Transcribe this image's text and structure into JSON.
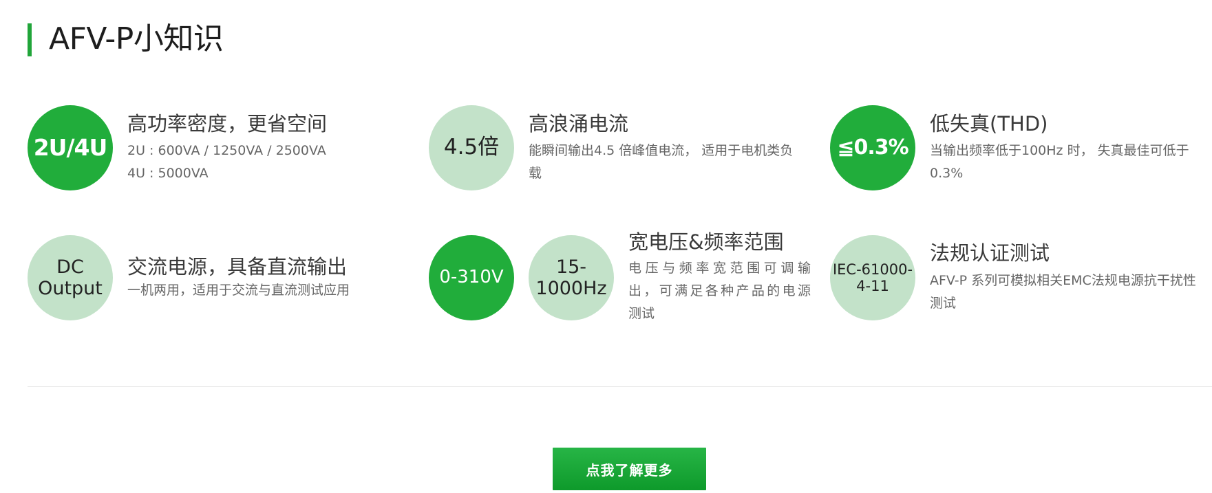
{
  "header": {
    "title": "AFV-P小知识"
  },
  "features": [
    {
      "badge": "2U/4U",
      "title": "高功率密度，更省空间",
      "lines": [
        "2U : 600VA / 1250VA / 2500VA",
        "4U : 5000VA"
      ]
    },
    {
      "badge": "4.5倍",
      "title": "高浪涌电流",
      "lines": [
        "能瞬间输出4.5 倍峰值电流， 适用于电机类负",
        "载"
      ]
    },
    {
      "badge": "≦0.3%",
      "title": "低失真(THD)",
      "lines": [
        "当输出频率低于100Hz 时， 失真最佳可低于",
        "0.3%"
      ]
    },
    {
      "badge_lines": [
        "DC",
        "Output"
      ],
      "title": "交流电源，具备直流输出",
      "lines": [
        "一机两用，适用于交流与直流测试应用"
      ]
    },
    {
      "badges": [
        {
          "text": "0-310V"
        },
        {
          "lines": [
            "15-",
            "1000Hz"
          ]
        }
      ],
      "title": "宽电压&频率范围",
      "lines": [
        "电压与频率宽范围可调输",
        "出，可满足各种产品的电源",
        "测试"
      ]
    },
    {
      "badge_lines": [
        "IEC-61000-",
        "4-11"
      ],
      "title": "法规认证测试",
      "lines": [
        "AFV-P 系列可模拟相关EMC法规电源抗干扰性",
        "测试"
      ]
    }
  ],
  "cta": {
    "label": "点我了解更多"
  },
  "colors": {
    "accent": "#21ad3b",
    "light_badge": "#c3e2c9"
  }
}
